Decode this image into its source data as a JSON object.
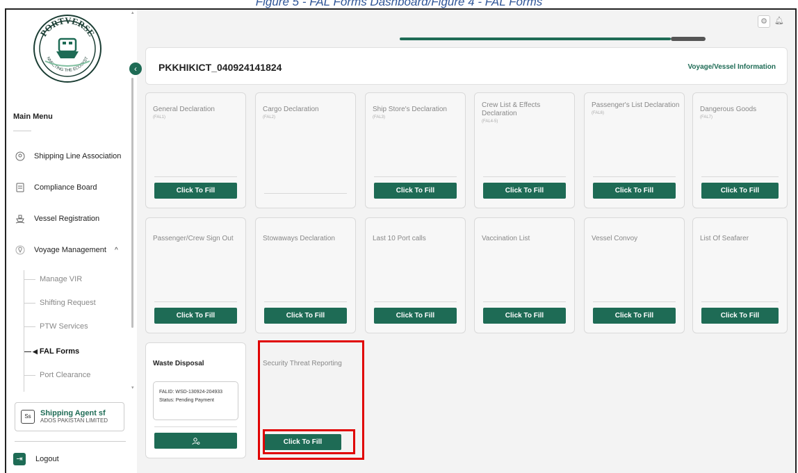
{
  "caption": "Figure 5 - FAL Forms Dashboard/Figure 4 - FAL Forms",
  "logo": {
    "text_top": "PORTVERSE",
    "text_bottom": "CONNECTING THE ECOSYSTEM"
  },
  "sidebar": {
    "main_menu_label": "Main Menu",
    "items": [
      {
        "label": "Shipping Line Association",
        "icon": "shield-icon"
      },
      {
        "label": "Compliance Board",
        "icon": "document-icon"
      },
      {
        "label": "Vessel Registration",
        "icon": "ship-icon"
      },
      {
        "label": "Voyage Management",
        "icon": "location-icon"
      }
    ],
    "sub_items": [
      {
        "label": "Manage VIR"
      },
      {
        "label": "Shifting Request"
      },
      {
        "label": "PTW Services"
      },
      {
        "label": "FAL Forms"
      },
      {
        "label": "Port Clearance"
      }
    ],
    "agent": {
      "initials": "Ss",
      "name": "Shipping Agent sf",
      "org": "ADOS PAKISTAN LIMITED"
    },
    "logout_label": "Logout"
  },
  "header": {
    "vessel_id": "PKKHIKICT_040924141824",
    "info_link": "Voyage/Vessel Information"
  },
  "cards": [
    {
      "title": "General Declaration",
      "sub": "(FAL1)",
      "button": "Click To Fill"
    },
    {
      "title": "Cargo Declaration",
      "sub": "(FAL2)",
      "button": ""
    },
    {
      "title": "Ship Store's Declaration",
      "sub": "(FAL3)",
      "button": "Click To Fill"
    },
    {
      "title": "Crew List & Effects Declaration",
      "sub": "(FAL4-5)",
      "button": "Click To Fill"
    },
    {
      "title": "Passenger's List Declaration",
      "sub": "(FAL6)",
      "button": "Click To Fill"
    },
    {
      "title": "Dangerous Goods",
      "sub": "(FAL7)",
      "button": "Click To Fill"
    },
    {
      "title": "Passenger/Crew Sign Out",
      "sub": "",
      "button": "Click To Fill"
    },
    {
      "title": "Stowaways Declaration",
      "sub": "",
      "button": "Click To Fill"
    },
    {
      "title": "Last 10 Port calls",
      "sub": "",
      "button": "Click To Fill"
    },
    {
      "title": "Vaccination List",
      "sub": "",
      "button": "Click To Fill"
    },
    {
      "title": "Vessel Convoy",
      "sub": "",
      "button": "Click To Fill"
    },
    {
      "title": "List Of Seafarer",
      "sub": "",
      "button": "Click To Fill"
    }
  ],
  "waste_card": {
    "title": "Waste Disposal",
    "fal_id": "FALID: WSD-130924-204933",
    "status": "Status: Pending Payment"
  },
  "security_card": {
    "title": "Security Threat Reporting",
    "button": "Click To Fill"
  },
  "colors": {
    "brand_green": "#1e6b55",
    "highlight_red": "#e00000"
  }
}
